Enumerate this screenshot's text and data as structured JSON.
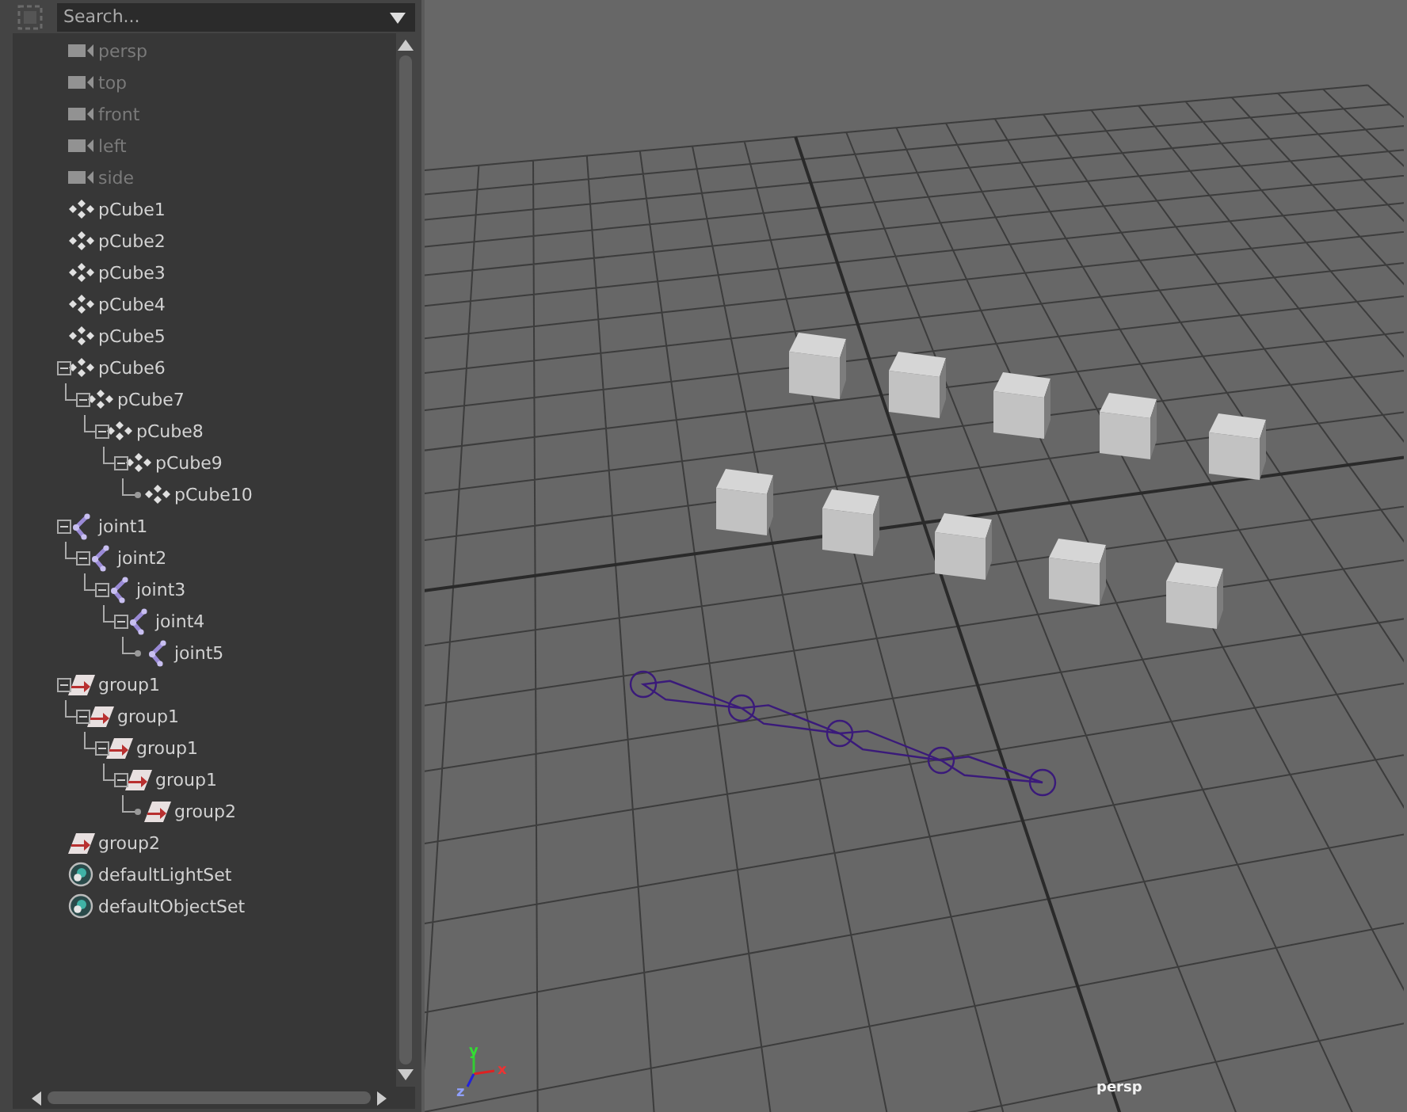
{
  "outliner": {
    "search": {
      "placeholder": "Search..."
    },
    "items": [
      {
        "kind": "camera",
        "label": "persp",
        "dimmed": true
      },
      {
        "kind": "camera",
        "label": "top",
        "dimmed": true
      },
      {
        "kind": "camera",
        "label": "front",
        "dimmed": true
      },
      {
        "kind": "camera",
        "label": "left",
        "dimmed": true
      },
      {
        "kind": "camera",
        "label": "side",
        "dimmed": true
      },
      {
        "kind": "mesh",
        "label": "pCube1",
        "dimmed": false
      },
      {
        "kind": "mesh",
        "label": "pCube2",
        "dimmed": false
      },
      {
        "kind": "mesh",
        "label": "pCube3",
        "dimmed": false
      },
      {
        "kind": "mesh",
        "label": "pCube4",
        "dimmed": false
      },
      {
        "kind": "mesh",
        "label": "pCube5",
        "dimmed": false
      },
      {
        "kind": "mesh",
        "label": "pCube6",
        "dimmed": false,
        "expanded": true,
        "children": [
          {
            "kind": "mesh",
            "label": "pCube7",
            "dimmed": false,
            "expanded": true,
            "children": [
              {
                "kind": "mesh",
                "label": "pCube8",
                "dimmed": false,
                "expanded": true,
                "children": [
                  {
                    "kind": "mesh",
                    "label": "pCube9",
                    "dimmed": false,
                    "expanded": true,
                    "children": [
                      {
                        "kind": "mesh",
                        "label": "pCube10",
                        "dimmed": false
                      }
                    ]
                  }
                ]
              }
            ]
          }
        ]
      },
      {
        "kind": "joint",
        "label": "joint1",
        "dimmed": false,
        "expanded": true,
        "children": [
          {
            "kind": "joint",
            "label": "joint2",
            "dimmed": false,
            "expanded": true,
            "children": [
              {
                "kind": "joint",
                "label": "joint3",
                "dimmed": false,
                "expanded": true,
                "children": [
                  {
                    "kind": "joint",
                    "label": "joint4",
                    "dimmed": false,
                    "expanded": true,
                    "children": [
                      {
                        "kind": "joint",
                        "label": "joint5",
                        "dimmed": false
                      }
                    ]
                  }
                ]
              }
            ]
          }
        ]
      },
      {
        "kind": "group",
        "label": "group1",
        "dimmed": false,
        "expanded": true,
        "children": [
          {
            "kind": "group",
            "label": "group1",
            "dimmed": false,
            "expanded": true,
            "children": [
              {
                "kind": "group",
                "label": "group1",
                "dimmed": false,
                "expanded": true,
                "children": [
                  {
                    "kind": "group",
                    "label": "group1",
                    "dimmed": false,
                    "expanded": true,
                    "children": [
                      {
                        "kind": "group",
                        "label": "group2",
                        "dimmed": false
                      }
                    ]
                  }
                ]
              }
            ]
          }
        ]
      },
      {
        "kind": "group",
        "label": "group2",
        "dimmed": false
      },
      {
        "kind": "set",
        "label": "defaultLightSet",
        "dimmed": false
      },
      {
        "kind": "set",
        "label": "defaultObjectSet",
        "dimmed": false
      }
    ]
  },
  "viewport": {
    "camera_label": "persp",
    "axes": [
      "x",
      "y",
      "z"
    ]
  }
}
